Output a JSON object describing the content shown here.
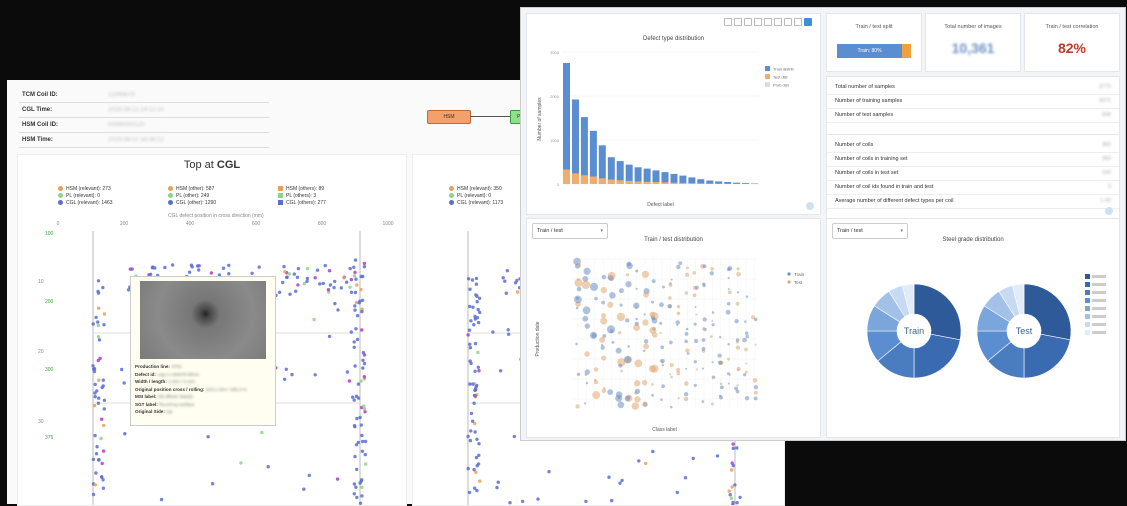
{
  "back": {
    "info_rows": [
      {
        "key": "TCM Coil ID:",
        "value": "12345678"
      },
      {
        "key": "CGL Time:",
        "value": "2019-08-12 14:12:10"
      },
      {
        "key": "HSM Coil ID:",
        "value": "HSM0000120"
      },
      {
        "key": "HSM Time:",
        "value": "2019-08-07 16:38:12"
      }
    ],
    "process_nodes": [
      "HSM",
      "PL"
    ],
    "chart_title_prefix": "Top at ",
    "chart_title_strong": "CGL",
    "legend_rows": [
      [
        "HSM (relevant): 273",
        "HSM (other): 587",
        "HSM (others): 89"
      ],
      [
        "PL (relevant): 0",
        "PL (other): 249",
        "PL (others): 3"
      ],
      [
        "CGL (relevant): 1463",
        "CGL (other): 1290",
        "CGL (others): 277"
      ]
    ],
    "right_legend": [
      "HSM (relevant): 350",
      "PL (relevant): 0",
      "CGL (relevant): 1173"
    ],
    "axis_caption": "CGL defect position in cross direction (mm)",
    "x_ticks": [
      "0",
      "200",
      "400",
      "600",
      "800",
      "1000"
    ],
    "y_ticks": [
      "10",
      "20",
      "30"
    ],
    "green_ticks": [
      "100",
      "200",
      "300",
      "375"
    ],
    "tooltip_lines": [
      {
        "k": "Production line:",
        "v": "4704"
      },
      {
        "k": "Defect id:",
        "v": "cog.i-c-494t76-0lmm"
      },
      {
        "k": "Width / length:",
        "v": "1 mm / 3 mm"
      },
      {
        "k": "Original position cross / rolling:",
        "v": "510.1 mm / 185.3 m"
      },
      {
        "k": "MSI label:",
        "v": "Oil-offerer (stack)"
      },
      {
        "k": "SGT label:",
        "v": "Ra-ref-sy-surface"
      },
      {
        "k": "Original Side:",
        "v": "top"
      }
    ]
  },
  "front": {
    "defect_chart": {
      "title": "Defect type distribution",
      "ylabel": "Number of samples",
      "xlabel": "Defect label",
      "legend": [
        "Train distrib",
        "Test dist",
        "Prob dist"
      ]
    },
    "train_test_chart": {
      "dropdown": "Train / test",
      "title": "Train / test distribution",
      "ylabel": "Production date",
      "xlabel": "Class label",
      "legend": [
        "Train",
        "Test"
      ]
    },
    "steel_chart": {
      "dropdown": "Train / test",
      "title": "Steel grade distribution",
      "donut_labels": [
        "Train",
        "Test"
      ]
    },
    "cards": [
      {
        "title": "Train / test split",
        "value": "Train: 80%"
      },
      {
        "title": "Total number of images",
        "value": "10,361"
      },
      {
        "title": "Train / test correlation",
        "value": "82%"
      }
    ],
    "samples_rows": [
      {
        "label": "Total number of samples",
        "value": "3770"
      },
      {
        "label": "Number of training samples",
        "value": "3072"
      },
      {
        "label": "Number of test samples",
        "value": "698"
      }
    ],
    "coils_rows": [
      {
        "label": "Number of coils",
        "value": "383"
      },
      {
        "label": "Number of coils in training set",
        "value": "283"
      },
      {
        "label": "Number of coils in test set",
        "value": "100"
      },
      {
        "label": "Number of coil ids found in train and test",
        "value": "0"
      },
      {
        "label": "Average number of different defect types per coil",
        "value": "1.40"
      }
    ],
    "chart_data": {
      "type": "bar",
      "title": "Defect type distribution",
      "xlabel": "Defect label",
      "ylabel": "Number of samples",
      "ylim": [
        0,
        3000
      ],
      "series": [
        {
          "name": "Train distrib",
          "values": [
            2750,
            1920,
            1520,
            1210,
            880,
            610,
            520,
            440,
            380,
            350,
            310,
            270,
            230,
            190,
            150,
            110,
            80,
            60,
            45,
            30,
            20,
            12
          ]
        },
        {
          "name": "Test dist",
          "values": [
            330,
            240,
            200,
            170,
            130,
            100,
            85,
            70,
            60,
            50,
            45,
            38,
            30,
            26,
            20,
            15,
            12,
            9,
            7,
            5,
            3,
            2
          ]
        }
      ],
      "colors": [
        "#5b8ed0",
        "#f0ad6b"
      ]
    }
  }
}
